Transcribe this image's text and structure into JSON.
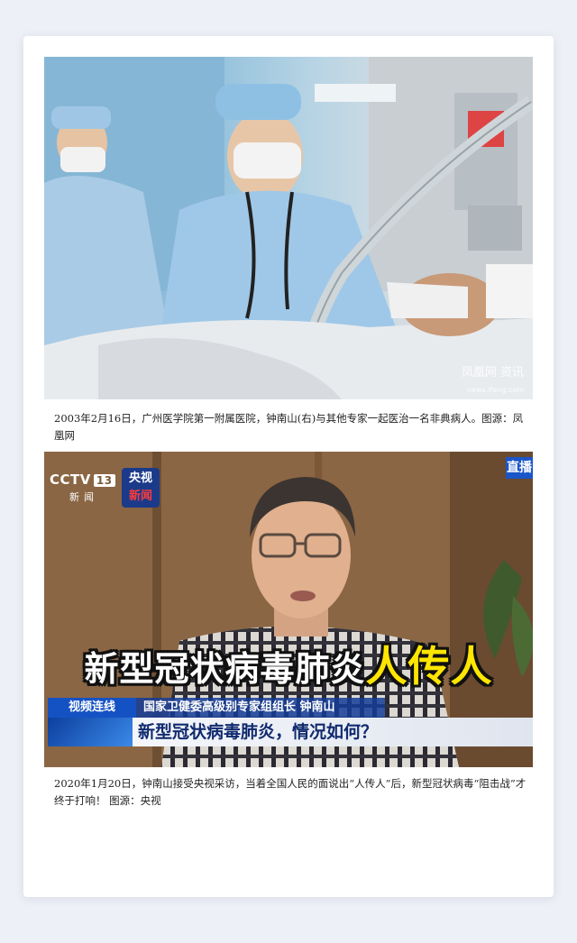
{
  "photo1": {
    "watermark": "凤凰网 资讯",
    "watermark_url": "news.ifeng.com"
  },
  "caption1": "2003年2月16日，广州医学院第一附属医院，钟南山(右)与其他专家一起医治一名非典病人。图源：凤凰网",
  "photo2": {
    "channel_logo": "CCTV",
    "channel_number": "13",
    "channel_sub": "新闻",
    "badge_line1": "央视",
    "badge_line2": "新闻",
    "live_badge": "直播",
    "headline_white": "新型冠状病毒肺炎",
    "headline_yellow": "人传人",
    "tag": "视频连线",
    "name_line": "国家卫健委高级别专家组组长 钟南山",
    "title_line": "新型冠状病毒肺炎，情况如何？"
  },
  "caption2": "2020年1月20日，钟南山接受央视采访，当着全国人民的面说出“人传人”后，新型冠状病毒“阻击战”才终于打响！ 图源：央视"
}
